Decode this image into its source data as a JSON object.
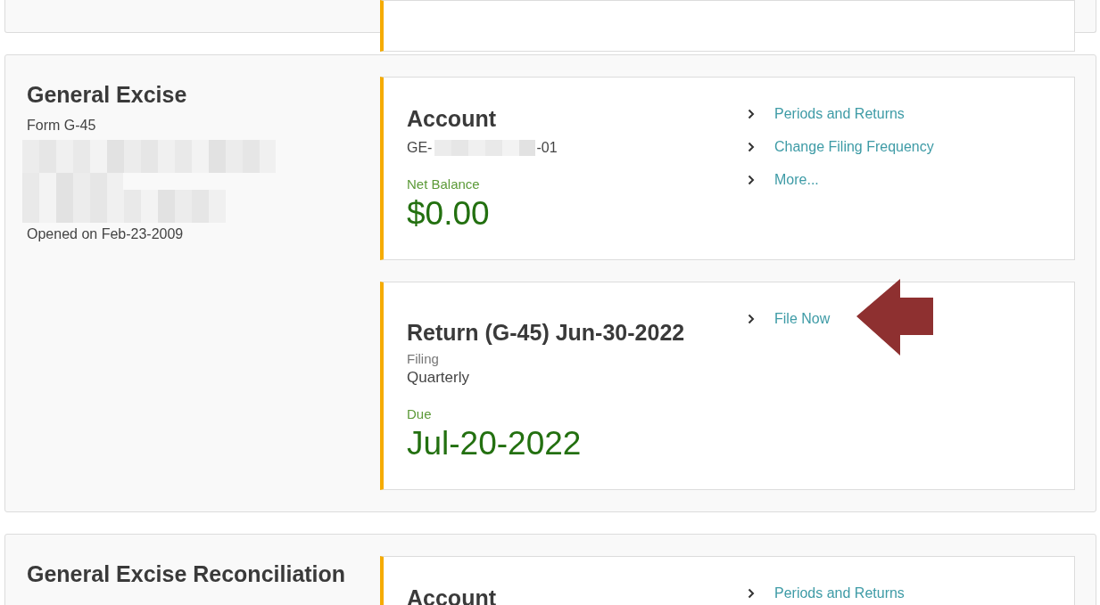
{
  "sections": [
    {
      "title": "General Excise",
      "form": "Form G-45",
      "opened": "Opened on Feb-23-2009",
      "cards": [
        {
          "kind": "account",
          "title": "Account",
          "number_prefix": "GE-",
          "number_suffix": "-01",
          "balance_label": "Net Balance",
          "balance": "$0.00",
          "links": [
            "Periods and Returns",
            "Change Filing Frequency",
            "More..."
          ]
        },
        {
          "kind": "return",
          "title": "Return (G-45) Jun-30-2022",
          "filing_label": "Filing",
          "filing": "Quarterly",
          "due_label": "Due",
          "due": "Jul-20-2022",
          "links": [
            "File Now"
          ],
          "highlighted": true
        }
      ]
    },
    {
      "title": "General Excise Reconciliation",
      "cards": [
        {
          "kind": "account",
          "title": "Account",
          "links": [
            "Periods and Returns"
          ]
        }
      ]
    }
  ]
}
